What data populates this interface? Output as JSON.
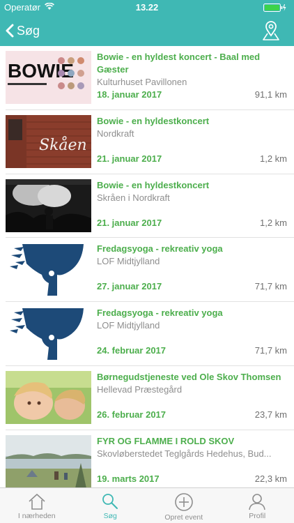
{
  "status_bar": {
    "carrier": "Operatør",
    "time": "13.22"
  },
  "nav": {
    "back_label": "Søg"
  },
  "events": [
    {
      "title": "Bowie - en hyldest koncert - Baal med Gæster",
      "venue": "Kulturhuset Pavillonen",
      "date": "18. januar 2017",
      "distance": "91,1 km",
      "thumb": "bowie-poster",
      "thumb_text": "BOWIE"
    },
    {
      "title": "Bowie - en hyldestkoncert",
      "venue": "Nordkraft",
      "date": "21. januar 2017",
      "distance": "1,2 km",
      "thumb": "brick-sign",
      "thumb_text": "Skåen"
    },
    {
      "title": "Bowie - en hyldestkoncert",
      "venue": "Skråen i Nordkraft",
      "date": "21. januar 2017",
      "distance": "1,2 km",
      "thumb": "concert"
    },
    {
      "title": "Fredagsyoga - rekreativ yoga",
      "venue": "LOF Midtjylland",
      "date": "27. januar 2017",
      "distance": "71,7 km",
      "thumb": "lof-logo"
    },
    {
      "title": "Fredagsyoga - rekreativ yoga",
      "venue": "LOF Midtjylland",
      "date": "24. februar 2017",
      "distance": "71,7 km",
      "thumb": "lof-logo"
    },
    {
      "title": "Børnegudstjeneste ved Ole Skov Thomsen",
      "venue": "Hellevad Præstegård",
      "date": "26. februar 2017",
      "distance": "23,7 km",
      "thumb": "child"
    },
    {
      "title": "FYR OG FLAMME I ROLD SKOV",
      "venue": "Skovløberstedet Teglgårds Hedehus, Bud...",
      "date": "19. marts 2017",
      "distance": "22,3 km",
      "thumb": "lake"
    }
  ],
  "tabs": [
    {
      "label": "I nærheden",
      "icon": "house-icon",
      "active": false
    },
    {
      "label": "Søg",
      "icon": "search-icon",
      "active": true
    },
    {
      "label": "Opret event",
      "icon": "plus-circle-icon",
      "active": false
    },
    {
      "label": "Profil",
      "icon": "person-icon",
      "active": false
    }
  ],
  "colors": {
    "accent": "#3fb8b4",
    "title_green": "#4cae4c",
    "venue_gray": "#8e8e8e"
  }
}
